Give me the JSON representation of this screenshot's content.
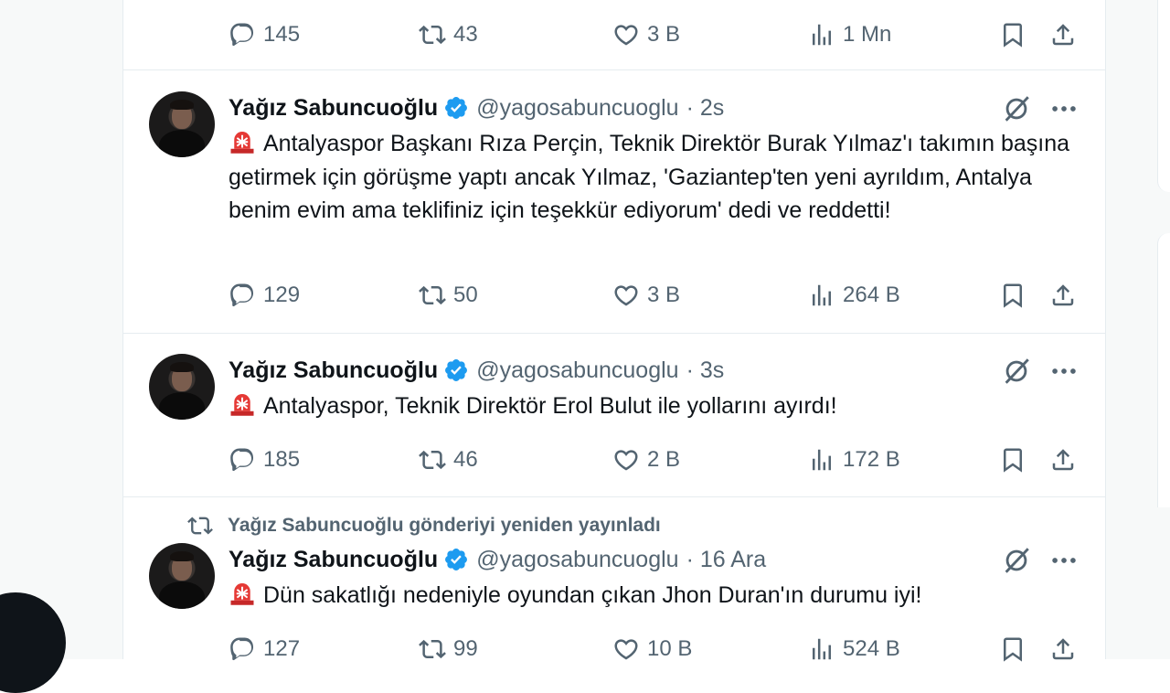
{
  "tweets": [
    {
      "stats": {
        "replies": "145",
        "retweets": "43",
        "likes": "3 B",
        "views": "1 Mn"
      }
    },
    {
      "author": "Yağız Sabuncuoğlu",
      "handle": "@yagosabuncuoglu",
      "time": "· 2s",
      "text": "Antalyaspor Başkanı Rıza Perçin, Teknik Direktör Burak Yılmaz'ı takımın başına getirmek için görüşme yaptı ancak Yılmaz, 'Gaziantep'ten yeni ayrıldım, Antalya benim evim ama teklifiniz için teşekkür ediyorum' dedi ve reddetti!",
      "stats": {
        "replies": "129",
        "retweets": "50",
        "likes": "3 B",
        "views": "264 B"
      }
    },
    {
      "author": "Yağız Sabuncuoğlu",
      "handle": "@yagosabuncuoglu",
      "time": "· 3s",
      "text": "Antalyaspor, Teknik Direktör Erol Bulut ile yollarını ayırdı!",
      "stats": {
        "replies": "185",
        "retweets": "46",
        "likes": "2 B",
        "views": "172 B"
      }
    },
    {
      "retweet_label": "Yağız Sabuncuoğlu gönderiyi yeniden yayınladı",
      "author": "Yağız Sabuncuoğlu",
      "handle": "@yagosabuncuoglu",
      "time": "· 16 Ara",
      "text": "Dün sakatlığı nedeniyle oyundan çıkan Jhon Duran'ın durumu iyi!",
      "stats": {
        "replies": "127",
        "retweets": "99",
        "likes": "10 B",
        "views": "524 B"
      }
    }
  ],
  "icons": {
    "reply": "reply-icon",
    "retweet": "retweet-icon",
    "like": "heart-icon",
    "views": "views-icon",
    "bookmark": "bookmark-icon",
    "share": "share-icon",
    "verified": "verified-badge-icon",
    "grok": "grok-icon",
    "more": "more-icon",
    "siren": "siren-emoji"
  },
  "colors": {
    "secondary": "#536471",
    "primary": "#0f1419",
    "verified": "#1d9bf0",
    "divider": "#e6ecf0"
  }
}
